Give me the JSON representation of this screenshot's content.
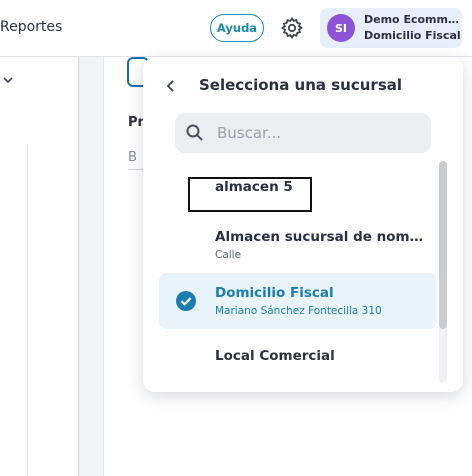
{
  "topbar": {
    "title": "Reportes",
    "help_label": "Ayuda",
    "settings_icon": "gear-icon",
    "account": {
      "initials": "SI",
      "name": "Demo Ecomm...",
      "subtitle": "Domicilio Fiscal",
      "avatar_color": "#8d53d6"
    }
  },
  "sidebar": {
    "collapse_icon": "chevron-down-icon"
  },
  "main": {
    "label": "Pr",
    "input_value": "B"
  },
  "branch_selector": {
    "heading": "Selecciona una sucursal",
    "back_icon": "chevron-left-icon",
    "search": {
      "placeholder": "Buscar...",
      "icon": "search-icon"
    },
    "items": [
      {
        "name": "almacen 5",
        "address": ""
      },
      {
        "name": "Almacen sucursal de nombre...",
        "address": "Calle"
      },
      {
        "name": "Domicilio Fiscal",
        "address": "Mariano Sánchez Fontecilla 310",
        "selected": true
      },
      {
        "name": "Local Comercial",
        "address": ""
      }
    ]
  },
  "colors": {
    "accent": "#1a7fb0",
    "selected_bg": "#e8f4fa"
  }
}
